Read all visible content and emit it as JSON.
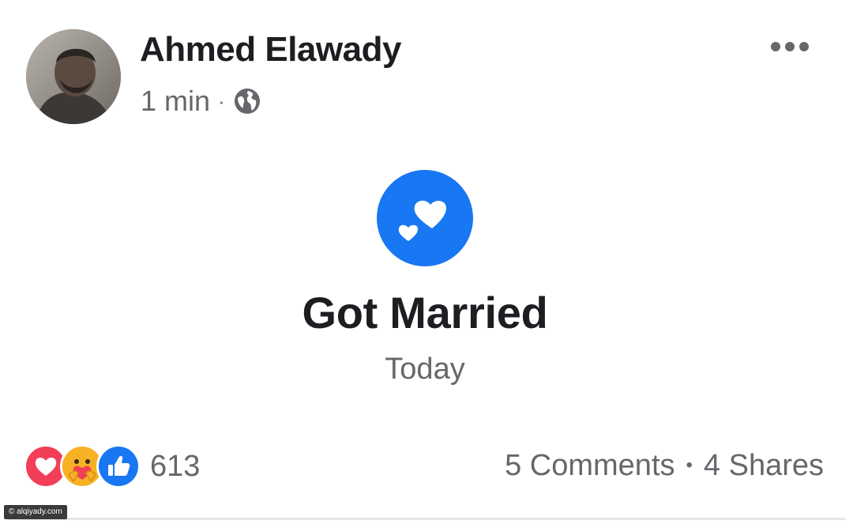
{
  "post": {
    "author": {
      "name": "Ahmed Elawady",
      "avatar_icon": "profile-photo"
    },
    "timestamp": "1 min",
    "separator": "·",
    "privacy_icon": "globe-icon",
    "more_icon": "more-horizontal-icon"
  },
  "life_event": {
    "icon": "hearts-icon",
    "icon_color": "#1877f2",
    "title": "Got Married",
    "date": "Today"
  },
  "engagement": {
    "reactions": [
      {
        "name": "love-reaction-icon",
        "color": "#f33e58"
      },
      {
        "name": "care-reaction-icon",
        "color": "#f7b125"
      },
      {
        "name": "like-reaction-icon",
        "color": "#1877f2"
      }
    ],
    "reaction_count": "613",
    "comments": "5 Comments",
    "separator": "•",
    "shares": "4 Shares"
  },
  "watermark": {
    "text": "© alqiyady.com"
  }
}
